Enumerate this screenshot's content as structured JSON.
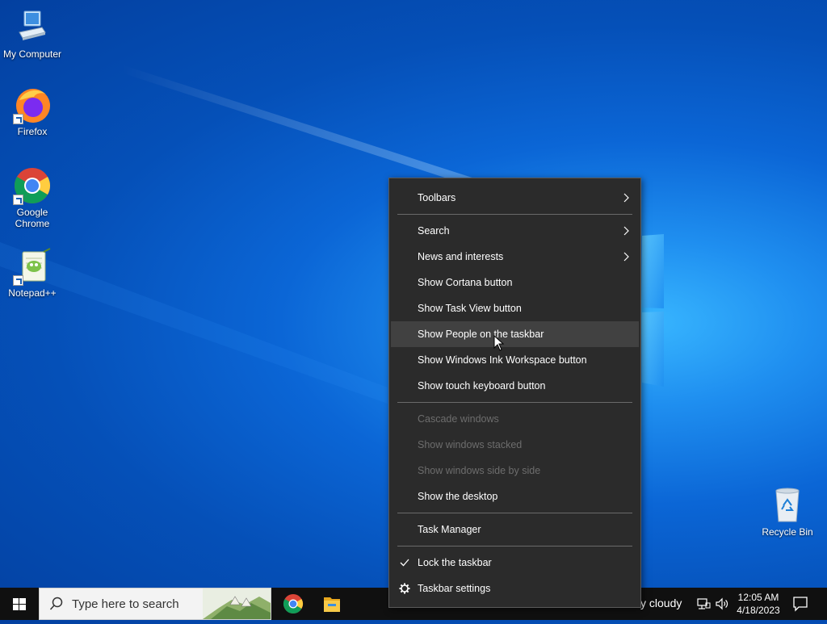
{
  "desktop": {
    "icons": [
      {
        "label": "My Computer",
        "icon": "computer-icon"
      },
      {
        "label": "Firefox",
        "icon": "firefox-icon"
      },
      {
        "label": "Google Chrome",
        "icon": "chrome-icon"
      },
      {
        "label": "Notepad++",
        "icon": "notepadpp-icon"
      },
      {
        "label": "Recycle Bin",
        "icon": "recycle-bin-icon"
      }
    ]
  },
  "context_menu": {
    "items": [
      {
        "label": "Toolbars",
        "submenu": true
      },
      {
        "label": "Search",
        "submenu": true
      },
      {
        "label": "News and interests",
        "submenu": true
      },
      {
        "label": "Show Cortana button"
      },
      {
        "label": "Show Task View button"
      },
      {
        "label": "Show People on the taskbar",
        "hovered": true
      },
      {
        "label": "Show Windows Ink Workspace button"
      },
      {
        "label": "Show touch keyboard button"
      },
      {
        "label": "Cascade windows",
        "disabled": true
      },
      {
        "label": "Show windows stacked",
        "disabled": true
      },
      {
        "label": "Show windows side by side",
        "disabled": true
      },
      {
        "label": "Show the desktop"
      },
      {
        "label": "Task Manager"
      },
      {
        "label": "Lock the taskbar",
        "checked": true
      },
      {
        "label": "Taskbar settings",
        "icon": "gear-icon"
      }
    ]
  },
  "taskbar": {
    "search_placeholder": "Type here to search",
    "pinned": [
      "chrome-icon",
      "file-explorer-icon"
    ],
    "weather_text": "y cloudy",
    "clock": {
      "time": "12:05 AM",
      "date": "4/18/2023"
    }
  },
  "colors": {
    "menu_bg": "#2b2b2b",
    "menu_hover": "#414141",
    "menu_disabled_text": "#6d6d6d",
    "taskbar_bg": "#101010"
  }
}
